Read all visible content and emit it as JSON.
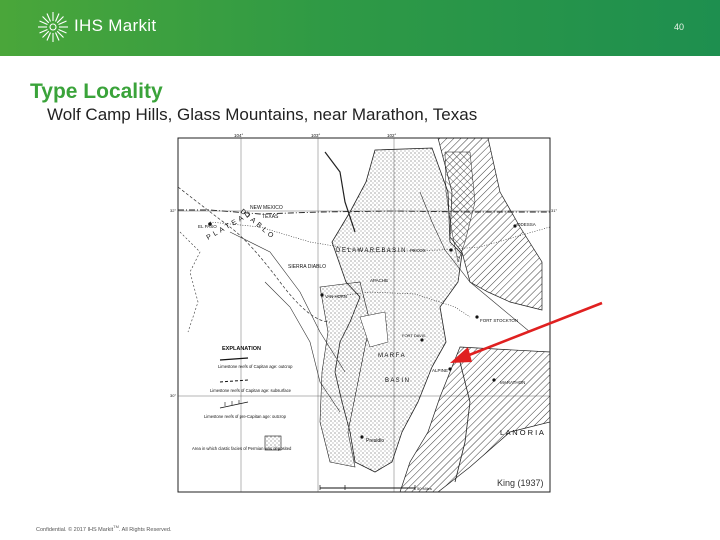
{
  "header": {
    "brand": "IHS Markit",
    "page_number": "40"
  },
  "slide": {
    "title": "Type Locality",
    "subtitle": "Wolf Camp Hills, Glass Mountains, near Marathon, Texas"
  },
  "map": {
    "credit": "King (1937)",
    "labels": {
      "new_mexico": "NEW MEXICO",
      "texas": "TEXAS",
      "el_paso": "EL PASO",
      "diablo": "DIABLO",
      "plateau": "PLATEAU",
      "delaware_basin": "D E L A W A R E   B A S I N",
      "sierra_diablo": "SIERRA DIABLO",
      "van_horn": "VAN HORN",
      "apache": "APACHE",
      "pecos": "PECOS",
      "odessa": "ODESSA",
      "fort_stockton": "FORT STOCKTON",
      "fort_davis": "FORT DAVIS",
      "marfa": "M A R F A",
      "basin": "B A S I N",
      "alpine": "ALPINE",
      "marathon": "MARATHON",
      "presidio": "Presidio",
      "llanoria": "L A N O R I A",
      "explanation": "EXPLANATION",
      "legend_1": "Limestone reefs of Capitan age: outcrop",
      "legend_2": "Limestone reefs of Capitan age: subsurface",
      "legend_3": "Limestone reefs of pre-Capitan age: outcrop",
      "legend_4": "Area in which clastic facies of Permian was deposited",
      "scale": "50 Miles",
      "lon_104": "104°",
      "lon_103": "103°",
      "lon_102": "102°",
      "lat_32": "32°",
      "lat_31": "31°",
      "lat_30": "30°"
    }
  },
  "footer": {
    "text": "Confidential. © 2017 IHS Markit",
    "tm": "TM",
    "rights": ". All Rights Reserved."
  },
  "colors": {
    "header_green": "#2f9a45",
    "title_green": "#3aa33a",
    "arrow_red": "#e02020"
  }
}
